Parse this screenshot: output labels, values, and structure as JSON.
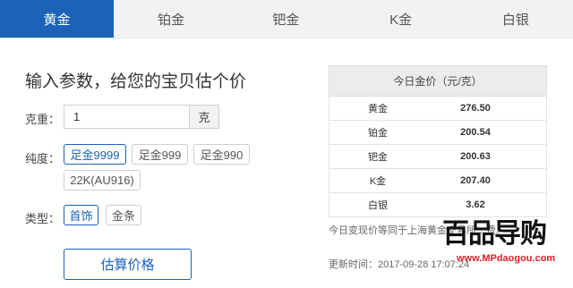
{
  "tabs": [
    {
      "label": "黄金",
      "active": true
    },
    {
      "label": "铂金",
      "active": false
    },
    {
      "label": "钯金",
      "active": false
    },
    {
      "label": "K金",
      "active": false
    },
    {
      "label": "白银",
      "active": false
    }
  ],
  "form": {
    "heading": "输入参数，给您的宝贝估个价",
    "weight_label": "克重：",
    "weight_value": "1",
    "weight_unit": "克",
    "purity_label": "纯度：",
    "purity_options": [
      "足金9999",
      "足金999",
      "足金990",
      "22K(AU916)"
    ],
    "purity_selected": "足金9999",
    "type_label": "类型：",
    "type_options": [
      "首饰",
      "金条"
    ],
    "type_selected": "首饰",
    "calc_button": "估算价格"
  },
  "prices": {
    "title": "今日金价（元/克）",
    "rows": [
      {
        "name": "黄金",
        "value": "276.50"
      },
      {
        "name": "铂金",
        "value": "200.54"
      },
      {
        "name": "钯金",
        "value": "200.63"
      },
      {
        "name": "K金",
        "value": "207.40"
      },
      {
        "name": "白银",
        "value": "3.62"
      }
    ],
    "note": "今日变现价等同于上海黄金交易所…费。",
    "update_time": "更新时间：2017-09-28 17:07:24"
  },
  "watermark": {
    "logo": "百品导购",
    "url": "www.MPdaogou.com"
  },
  "colors": {
    "accent": "#1b63b7"
  }
}
